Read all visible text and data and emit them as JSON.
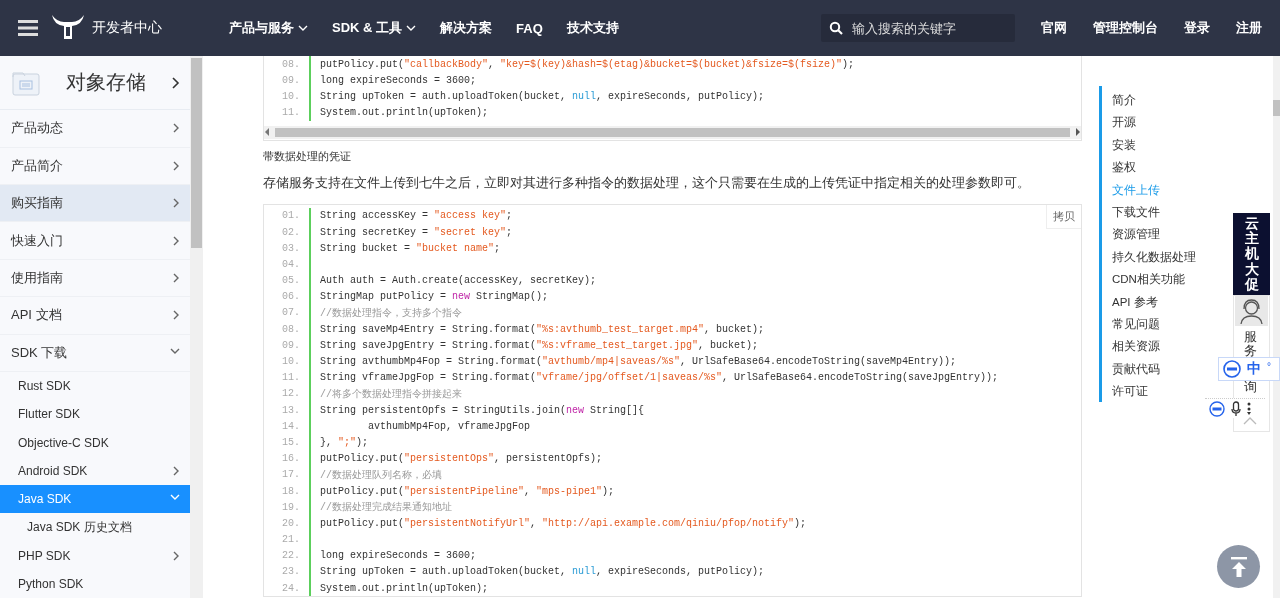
{
  "header": {
    "title": "开发者中心",
    "nav": [
      {
        "label": "产品与服务",
        "dropdown": true
      },
      {
        "label": "SDK & 工具",
        "dropdown": true
      },
      {
        "label": "解决方案"
      },
      {
        "label": "FAQ"
      },
      {
        "label": "技术支持"
      }
    ],
    "search": {
      "placeholder": "输入搜索的关键字"
    },
    "links": [
      "官网",
      "管理控制台",
      "登录",
      "注册"
    ]
  },
  "sidebar": {
    "title": "对象存储",
    "items": [
      {
        "label": "产品动态",
        "selected": false,
        "highlighted": false,
        "expanded": false
      },
      {
        "label": "产品简介",
        "selected": false,
        "highlighted": false,
        "expanded": false
      },
      {
        "label": "购买指南",
        "selected": false,
        "highlighted": true,
        "expanded": false
      },
      {
        "label": "快速入门",
        "selected": false,
        "highlighted": false,
        "expanded": false
      },
      {
        "label": "使用指南",
        "selected": false,
        "highlighted": false,
        "expanded": false
      },
      {
        "label": "API 文档",
        "selected": false,
        "highlighted": false,
        "expanded": false
      },
      {
        "label": "SDK 下载",
        "selected": false,
        "highlighted": false,
        "expanded": true,
        "children": [
          {
            "label": "Rust SDK",
            "selected": false
          },
          {
            "label": "Flutter SDK",
            "selected": false
          },
          {
            "label": "Objective-C SDK",
            "selected": false
          },
          {
            "label": "Android SDK",
            "selected": false,
            "expanded": false
          },
          {
            "label": "Java SDK",
            "selected": true,
            "expanded": true,
            "children": [
              {
                "label": "Java SDK 历史文档",
                "selected": false
              }
            ]
          },
          {
            "label": "PHP SDK",
            "selected": false,
            "expanded": false
          },
          {
            "label": "Python SDK",
            "selected": false
          }
        ]
      }
    ]
  },
  "content": [
    {
      "kind": "code",
      "lines": [
        {
          "number": "08.",
          "parts": [
            {
              "kind": "plain",
              "text": "putPolicy.put("
            },
            {
              "kind": "string",
              "text": "\"callbackBody\""
            },
            {
              "kind": "plain",
              "text": ", "
            },
            {
              "kind": "string",
              "text": "\"key=$(key)&hash=$(etag)&bucket=$(bucket)&fsize=$(fsize)\""
            },
            {
              "kind": "plain",
              "text": ");"
            }
          ]
        },
        {
          "number": "09.",
          "parts": [
            {
              "kind": "plain",
              "text": "long expireSeconds = 3600;"
            }
          ]
        },
        {
          "number": "10.",
          "parts": [
            {
              "kind": "plain",
              "text": "String upToken = auth.uploadToken(bucket, "
            },
            {
              "kind": "literal",
              "text": "null"
            },
            {
              "kind": "plain",
              "text": ", expireSeconds, putPolicy);"
            }
          ]
        },
        {
          "number": "11.",
          "parts": [
            {
              "kind": "plain",
              "text": "System.out.println(upToken);"
            }
          ]
        }
      ]
    },
    {
      "kind": "subheading",
      "text": "带数据处理的凭证"
    },
    {
      "kind": "paragraph",
      "text": "存储服务支持在文件上传到七牛之后，立即对其进行多种指令的数据处理，这个只需要在生成的上传凭证中指定相关的处理参数即可。"
    },
    {
      "kind": "code",
      "copy_label": "拷贝",
      "lines": [
        {
          "number": "01.",
          "parts": [
            {
              "kind": "plain",
              "text": "String accessKey = "
            },
            {
              "kind": "string",
              "text": "\"access key\""
            },
            {
              "kind": "plain",
              "text": ";"
            }
          ]
        },
        {
          "number": "02.",
          "parts": [
            {
              "kind": "plain",
              "text": "String secretKey = "
            },
            {
              "kind": "string",
              "text": "\"secret key\""
            },
            {
              "kind": "plain",
              "text": ";"
            }
          ]
        },
        {
          "number": "03.",
          "parts": [
            {
              "kind": "plain",
              "text": "String bucket = "
            },
            {
              "kind": "string",
              "text": "\"bucket name\""
            },
            {
              "kind": "plain",
              "text": ";"
            }
          ]
        },
        {
          "number": "04."
        },
        {
          "number": "05.",
          "parts": [
            {
              "kind": "plain",
              "text": "Auth auth = Auth.create(accessKey, secretKey);"
            }
          ]
        },
        {
          "number": "06.",
          "parts": [
            {
              "kind": "plain",
              "text": "StringMap putPolicy = "
            },
            {
              "kind": "keyword",
              "text": "new"
            },
            {
              "kind": "plain",
              "text": " StringMap();"
            }
          ]
        },
        {
          "number": "07.",
          "parts": [
            {
              "kind": "comment",
              "text": "//数据处理指令，支持多个指令"
            }
          ]
        },
        {
          "number": "08.",
          "parts": [
            {
              "kind": "plain",
              "text": "String saveMp4Entry = String.format("
            },
            {
              "kind": "string",
              "text": "\"%s:avthumb_test_target.mp4\""
            },
            {
              "kind": "plain",
              "text": ", bucket);"
            }
          ]
        },
        {
          "number": "09.",
          "parts": [
            {
              "kind": "plain",
              "text": "String saveJpgEntry = String.format("
            },
            {
              "kind": "string",
              "text": "\"%s:vframe_test_target.jpg\""
            },
            {
              "kind": "plain",
              "text": ", bucket);"
            }
          ]
        },
        {
          "number": "10.",
          "parts": [
            {
              "kind": "plain",
              "text": "String avthumbMp4Fop = String.format("
            },
            {
              "kind": "string",
              "text": "\"avthumb/mp4|saveas/%s\""
            },
            {
              "kind": "plain",
              "text": ", UrlSafeBase64.encodeToString(saveMp4Entry));"
            }
          ]
        },
        {
          "number": "11.",
          "parts": [
            {
              "kind": "plain",
              "text": "String vframeJpgFop = String.format("
            },
            {
              "kind": "string",
              "text": "\"vframe/jpg/offset/1|saveas/%s\""
            },
            {
              "kind": "plain",
              "text": ", UrlSafeBase64.encodeToString(saveJpgEntry));"
            }
          ]
        },
        {
          "number": "12.",
          "parts": [
            {
              "kind": "comment",
              "text": "//将多个数据处理指令拼接起来"
            }
          ]
        },
        {
          "number": "13.",
          "parts": [
            {
              "kind": "plain",
              "text": "String persistentOpfs = StringUtils.join("
            },
            {
              "kind": "keyword",
              "text": "new"
            },
            {
              "kind": "plain",
              "text": " String[]{"
            }
          ]
        },
        {
          "number": "14.",
          "parts": [
            {
              "kind": "plain",
              "text": "        avthumbMp4Fop, vframeJpgFop"
            }
          ]
        },
        {
          "number": "15.",
          "parts": [
            {
              "kind": "plain",
              "text": "}, "
            },
            {
              "kind": "string",
              "text": "\";\""
            },
            {
              "kind": "plain",
              "text": ");"
            }
          ]
        },
        {
          "number": "16.",
          "parts": [
            {
              "kind": "plain",
              "text": "putPolicy.put("
            },
            {
              "kind": "string",
              "text": "\"persistentOps\""
            },
            {
              "kind": "plain",
              "text": ", persistentOpfs);"
            }
          ]
        },
        {
          "number": "17.",
          "parts": [
            {
              "kind": "comment",
              "text": "//数据处理队列名称，必填"
            }
          ]
        },
        {
          "number": "18.",
          "parts": [
            {
              "kind": "plain",
              "text": "putPolicy.put("
            },
            {
              "kind": "string",
              "text": "\"persistentPipeline\""
            },
            {
              "kind": "plain",
              "text": ", "
            },
            {
              "kind": "string",
              "text": "\"mps-pipe1\""
            },
            {
              "kind": "plain",
              "text": ");"
            }
          ]
        },
        {
          "number": "19.",
          "parts": [
            {
              "kind": "comment",
              "text": "//数据处理完成结果通知地址"
            }
          ]
        },
        {
          "number": "20.",
          "parts": [
            {
              "kind": "plain",
              "text": "putPolicy.put("
            },
            {
              "kind": "string",
              "text": "\"persistentNotifyUrl\""
            },
            {
              "kind": "plain",
              "text": ", "
            },
            {
              "kind": "string",
              "text": "\"http://api.example.com/qiniu/pfop/notify\""
            },
            {
              "kind": "plain",
              "text": ");"
            }
          ]
        },
        {
          "number": "21."
        },
        {
          "number": "22.",
          "parts": [
            {
              "kind": "plain",
              "text": "long expireSeconds = 3600;"
            }
          ]
        },
        {
          "number": "23.",
          "parts": [
            {
              "kind": "plain",
              "text": "String upToken = auth.uploadToken(bucket, "
            },
            {
              "kind": "literal",
              "text": "null"
            },
            {
              "kind": "plain",
              "text": ", expireSeconds, putPolicy);"
            }
          ]
        },
        {
          "number": "24.",
          "parts": [
            {
              "kind": "plain",
              "text": "System.out.println(upToken);"
            }
          ]
        }
      ]
    }
  ],
  "toc": [
    {
      "label": "简介",
      "selected": false
    },
    {
      "label": "开源",
      "selected": false
    },
    {
      "label": "安装",
      "selected": false
    },
    {
      "label": "鉴权",
      "selected": false
    },
    {
      "label": "文件上传",
      "selected": true
    },
    {
      "label": "下载文件",
      "selected": false
    },
    {
      "label": "资源管理",
      "selected": false
    },
    {
      "label": "持久化数据处理",
      "selected": false
    },
    {
      "label": "CDN相关功能",
      "selected": false
    },
    {
      "label": "API 参考",
      "selected": false
    },
    {
      "label": "常见问题",
      "selected": false
    },
    {
      "label": "相关资源",
      "selected": false
    },
    {
      "label": "贡献代码",
      "selected": false
    },
    {
      "label": "许可证",
      "selected": false
    }
  ],
  "float": {
    "promo": "云主机大促",
    "service_top": "服务",
    "service_bottom": "询",
    "ime_label": "中",
    "ime_mark": "°"
  }
}
